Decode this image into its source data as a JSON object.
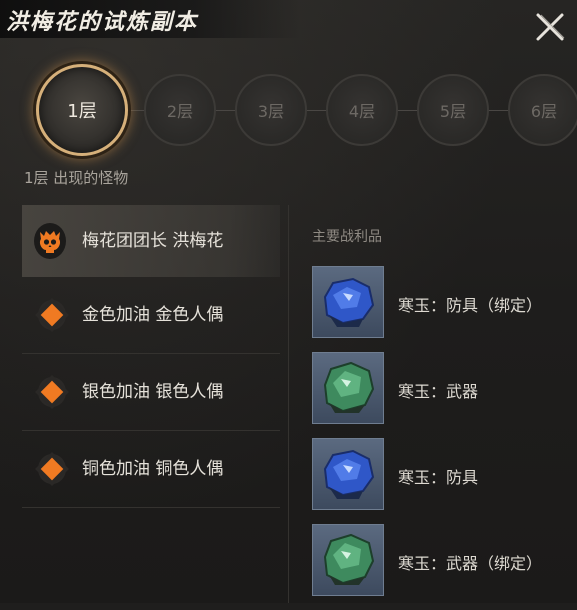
{
  "window": {
    "title": "洪梅花的试炼副本"
  },
  "floors": [
    {
      "label": "1层",
      "active": true
    },
    {
      "label": "2层",
      "active": false
    },
    {
      "label": "3层",
      "active": false
    },
    {
      "label": "4层",
      "active": false
    },
    {
      "label": "5层",
      "active": false
    },
    {
      "label": "6层",
      "active": false
    }
  ],
  "floor_caption": "1层 出现的怪物",
  "monsters": [
    {
      "name": "梅花团团长 洪梅花",
      "icon": "skull-icon",
      "selected": true
    },
    {
      "name": "金色加油 金色人偶",
      "icon": "orange-diamond-icon",
      "selected": false
    },
    {
      "name": "银色加油 银色人偶",
      "icon": "orange-diamond-icon",
      "selected": false
    },
    {
      "name": "铜色加油 铜色人偶",
      "icon": "orange-diamond-icon",
      "selected": false
    }
  ],
  "loot": {
    "title": "主要战利品",
    "items": [
      {
        "name": "寒玉：防具（绑定）",
        "icon": "blue-jade-icon",
        "color": "#2f57c8"
      },
      {
        "name": "寒玉：武器",
        "icon": "green-jade-icon",
        "color": "#3e8a5e"
      },
      {
        "name": "寒玉：防具",
        "icon": "blue-jade-icon",
        "color": "#2f57c8"
      },
      {
        "name": "寒玉：武器（绑定）",
        "icon": "green-jade-icon",
        "color": "#3e8a5e"
      }
    ]
  },
  "colors": {
    "accent_gold": "#d6b07a",
    "monster_marker": "#f07a22"
  }
}
